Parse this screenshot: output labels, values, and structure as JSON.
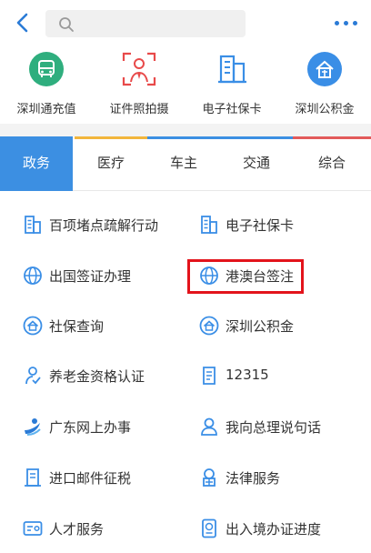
{
  "header": {
    "search_placeholder": "",
    "back_icon": "back-chevron-icon",
    "more_icon": "more-dots-icon"
  },
  "quick_services": [
    {
      "label": "深圳通充值",
      "icon": "bus-card-icon",
      "color": "#2fae7e"
    },
    {
      "label": "证件照拍摄",
      "icon": "id-photo-icon",
      "color": "#e84a4a"
    },
    {
      "label": "电子社保卡",
      "icon": "building-card-icon",
      "color": "#3a8ee6"
    },
    {
      "label": "深圳公积金",
      "icon": "housing-fund-icon",
      "color": "#3a8ee6"
    }
  ],
  "tabs": [
    {
      "label": "政务",
      "active": true,
      "color": "#3c8fe2"
    },
    {
      "label": "医疗",
      "active": false,
      "color": "#f2b53c"
    },
    {
      "label": "车主",
      "active": false,
      "color": "#3c8fe2"
    },
    {
      "label": "交通",
      "active": false,
      "color": "#3c8fe2"
    },
    {
      "label": "综合",
      "active": false,
      "color": "#e25a5a"
    }
  ],
  "services": [
    {
      "label": "百项堵点疏解行动",
      "icon": "building-icon"
    },
    {
      "label": "电子社保卡",
      "icon": "building-icon"
    },
    {
      "label": "出国签证办理",
      "icon": "globe-icon"
    },
    {
      "label": "港澳台签注",
      "icon": "globe-icon"
    },
    {
      "label": "社保查询",
      "icon": "house-shield-icon"
    },
    {
      "label": "深圳公积金",
      "icon": "house-shield-icon"
    },
    {
      "label": "养老金资格认证",
      "icon": "person-check-icon"
    },
    {
      "label": "12315",
      "icon": "document-icon"
    },
    {
      "label": "广东网上办事",
      "icon": "guangdong-logo-icon"
    },
    {
      "label": "我向总理说句话",
      "icon": "person-icon"
    },
    {
      "label": "进口邮件征税",
      "icon": "mail-document-icon"
    },
    {
      "label": "法律服务",
      "icon": "justice-icon"
    },
    {
      "label": "人才服务",
      "icon": "id-card-icon"
    },
    {
      "label": "出入境办证进度",
      "icon": "passport-icon"
    }
  ],
  "accent_color": "#3c8fe2",
  "highlight_color": "#e3131b"
}
